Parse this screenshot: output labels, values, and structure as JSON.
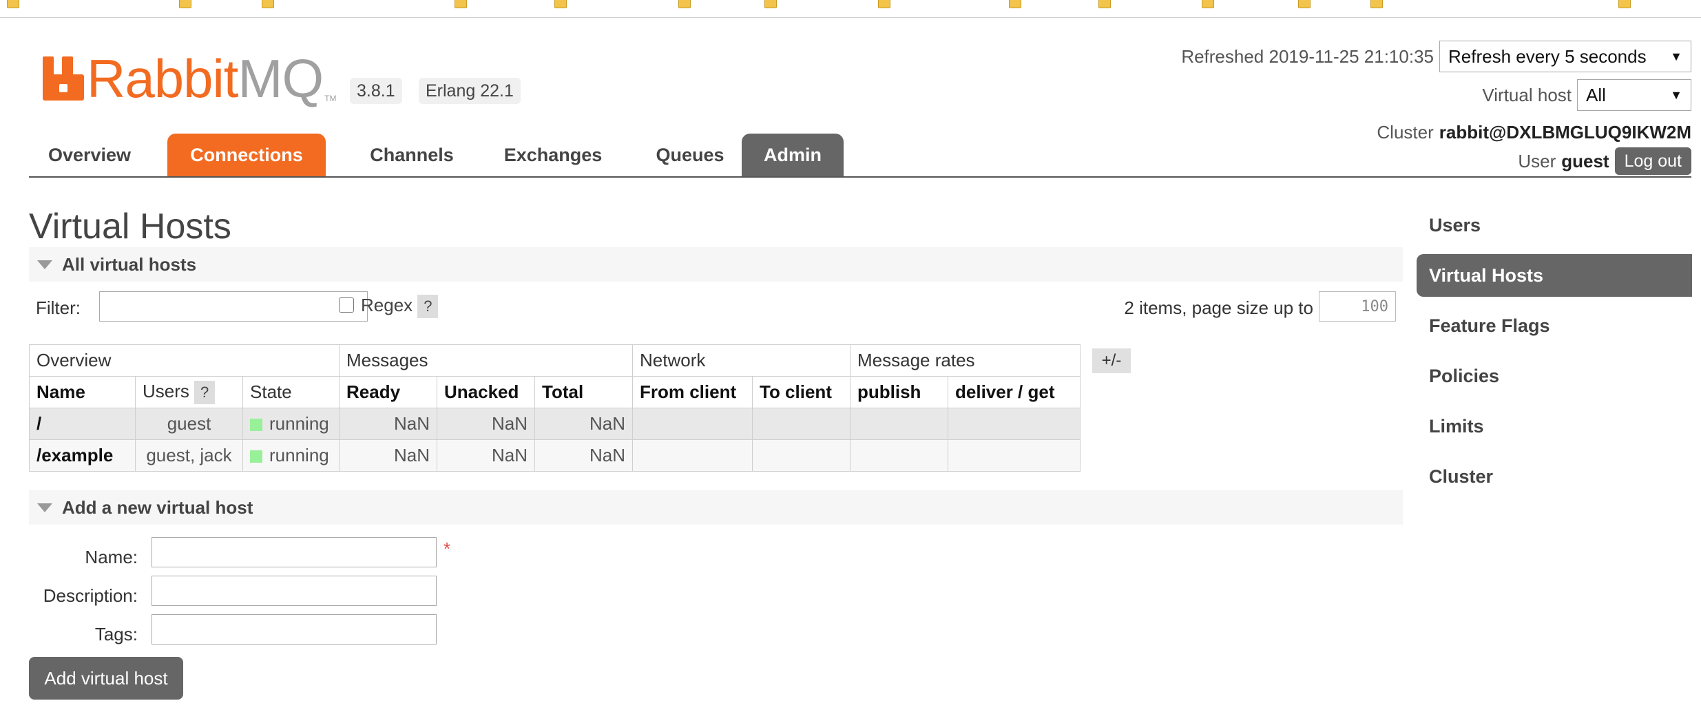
{
  "header": {
    "logo_text_rabbit": "Rabbit",
    "logo_text_mq": "MQ",
    "logo_tm": "TM",
    "version": "3.8.1",
    "erlang": "Erlang 22.1",
    "refreshed_label": "Refreshed 2019-11-25 21:10:35",
    "refresh_option": "Refresh every 5 seconds",
    "vhost_label": "Virtual host",
    "vhost_value": "All",
    "cluster_label": "Cluster",
    "cluster_value": "rabbit@DXLBMGLUQ9IKW2M",
    "user_label": "User",
    "user_value": "guest",
    "logout_label": "Log out"
  },
  "nav": {
    "tabs": [
      {
        "label": "Overview"
      },
      {
        "label": "Connections"
      },
      {
        "label": "Channels"
      },
      {
        "label": "Exchanges"
      },
      {
        "label": "Queues"
      },
      {
        "label": "Admin"
      }
    ]
  },
  "main": {
    "title": "Virtual Hosts",
    "all_section": "All virtual hosts",
    "filter_label": "Filter:",
    "regex_label": "Regex",
    "help": "?",
    "items_info": "2 items, page size up to",
    "page_size": "100",
    "toggle_columns": "+/-",
    "group_headers": [
      "Overview",
      "Messages",
      "Network",
      "Message rates"
    ],
    "columns": [
      "Name",
      "Users",
      "State",
      "Ready",
      "Unacked",
      "Total",
      "From client",
      "To client",
      "publish",
      "deliver / get"
    ],
    "rows": [
      {
        "name": "/",
        "users": "guest",
        "state": "running",
        "ready": "NaN",
        "unacked": "NaN",
        "total": "NaN"
      },
      {
        "name": "/example",
        "users": "guest, jack",
        "state": "running",
        "ready": "NaN",
        "unacked": "NaN",
        "total": "NaN"
      }
    ],
    "add_section": "Add a new virtual host",
    "form": {
      "name_label": "Name:",
      "description_label": "Description:",
      "tags_label": "Tags:",
      "required_mark": "*",
      "submit": "Add virtual host"
    }
  },
  "sidebar": {
    "items": [
      {
        "label": "Users"
      },
      {
        "label": "Virtual Hosts"
      },
      {
        "label": "Feature Flags"
      },
      {
        "label": "Policies"
      },
      {
        "label": "Limits"
      },
      {
        "label": "Cluster"
      }
    ]
  },
  "colors": {
    "brand_orange": "#f26b21",
    "active_gray": "#666666",
    "running_green": "#98f098"
  }
}
